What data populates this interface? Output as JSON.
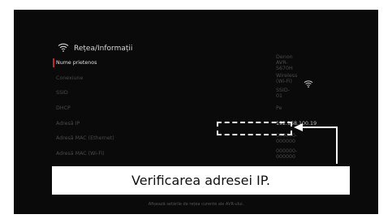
{
  "header": {
    "title": "Rețea/Informații",
    "icon": "wifi-icon"
  },
  "rows": [
    {
      "label": "Nume prietenos",
      "value": "Denon AVR-S670H",
      "selected": true
    },
    {
      "label": "Conexiune",
      "value": "Wireless (Wi-Fi)"
    },
    {
      "label": "SSID",
      "value": "SSID-01"
    },
    {
      "label": "DHCP",
      "value": "Pe"
    },
    {
      "label": "Adresă IP",
      "value": "192.168.100.19"
    },
    {
      "label": "Adresă MAC (Ethernet)",
      "value": "000000-000000"
    },
    {
      "label": "Adresă MAC (Wi-Fi)",
      "value": "000000-000000"
    }
  ],
  "callout": {
    "text": "Verificarea adresei IP."
  },
  "footer": {
    "text": "Afișează setările de rețea curente ale AVR-ului."
  },
  "colors": {
    "accent": "#c0282c",
    "background": "#0a0a0a"
  }
}
